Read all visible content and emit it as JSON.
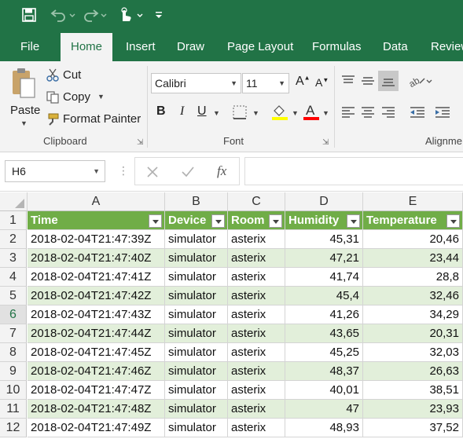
{
  "quick_access": {
    "icons": [
      "save-icon",
      "undo-icon",
      "redo-icon",
      "touch-mode-icon",
      "customize-icon"
    ]
  },
  "tabs": [
    "File",
    "Home",
    "Insert",
    "Draw",
    "Page Layout",
    "Formulas",
    "Data",
    "Review"
  ],
  "active_tab": "Home",
  "ribbon": {
    "clipboard": {
      "paste": "Paste",
      "cut": "Cut",
      "copy": "Copy",
      "format_painter": "Format Painter",
      "group_label": "Clipboard"
    },
    "font": {
      "font_name": "Calibri",
      "font_size": "11",
      "bold": "B",
      "italic": "I",
      "underline": "U",
      "group_label": "Font",
      "fill_color": "#ffff00",
      "font_color": "#ff0000"
    },
    "alignment": {
      "group_label": "Alignme"
    }
  },
  "formula_bar": {
    "name_box": "H6",
    "fx": "fx",
    "formula": ""
  },
  "sheet": {
    "columns": [
      "A",
      "B",
      "C",
      "D",
      "E"
    ],
    "header_row": [
      "Time",
      "Device",
      "Room",
      "Humidity",
      "Temperature"
    ],
    "row_numbers": [
      "1",
      "2",
      "3",
      "4",
      "5",
      "6",
      "7",
      "8",
      "9",
      "10",
      "11",
      "12"
    ],
    "selected_row": "6",
    "rows": [
      [
        "2018-02-04T21:47:39Z",
        "simulator",
        "asterix",
        "45,31",
        "20,46"
      ],
      [
        "2018-02-04T21:47:40Z",
        "simulator",
        "asterix",
        "47,21",
        "23,44"
      ],
      [
        "2018-02-04T21:47:41Z",
        "simulator",
        "asterix",
        "41,74",
        "28,8"
      ],
      [
        "2018-02-04T21:47:42Z",
        "simulator",
        "asterix",
        "45,4",
        "32,46"
      ],
      [
        "2018-02-04T21:47:43Z",
        "simulator",
        "asterix",
        "41,26",
        "34,29"
      ],
      [
        "2018-02-04T21:47:44Z",
        "simulator",
        "asterix",
        "43,65",
        "20,31"
      ],
      [
        "2018-02-04T21:47:45Z",
        "simulator",
        "asterix",
        "45,25",
        "32,03"
      ],
      [
        "2018-02-04T21:47:46Z",
        "simulator",
        "asterix",
        "48,37",
        "26,63"
      ],
      [
        "2018-02-04T21:47:47Z",
        "simulator",
        "asterix",
        "40,01",
        "38,51"
      ],
      [
        "2018-02-04T21:47:48Z",
        "simulator",
        "asterix",
        "47",
        "23,93"
      ],
      [
        "2018-02-04T21:47:49Z",
        "simulator",
        "asterix",
        "48,93",
        "37,52"
      ]
    ],
    "colors": {
      "header": "#70ad47",
      "band": "#e2efda",
      "plain": "#ffffff"
    }
  }
}
